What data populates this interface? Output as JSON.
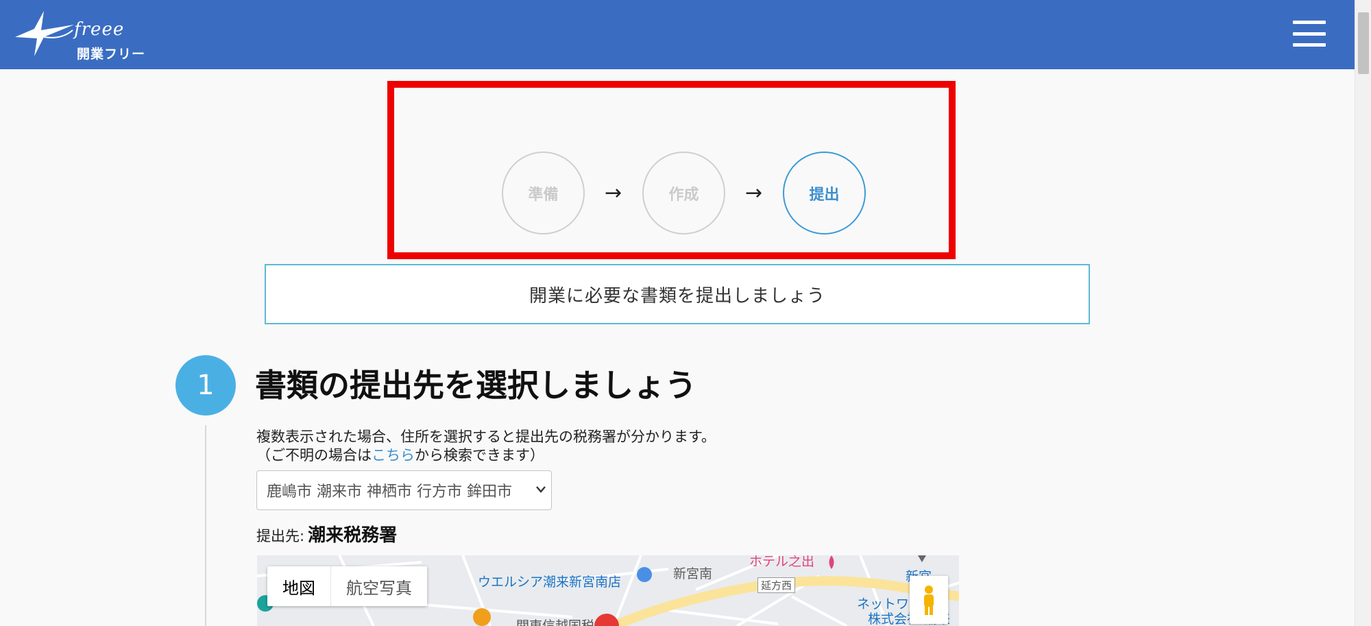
{
  "header": {
    "logo_script": "freee",
    "logo_title": "開業フリー"
  },
  "steps": [
    {
      "label": "準備",
      "state": "done"
    },
    {
      "label": "作成",
      "state": "done"
    },
    {
      "label": "提出",
      "state": "active"
    }
  ],
  "step_arrow": "→",
  "banner_text": "開業に必要な書類を提出しましょう",
  "section1": {
    "number": "1",
    "title": "書類の提出先を選択しましょう",
    "desc_line1": "複数表示された場合、住所を選択すると提出先の税務署が分かります。",
    "desc_line2_pre": "（ご不明の場合は",
    "desc_line2_link": "こちら",
    "desc_line2_post": "から検索できます）",
    "select_value": "鹿嶋市 潮来市 神栖市 行方市 鉾田市",
    "destination_label": "提出先:",
    "destination_value": "潮来税務署"
  },
  "map": {
    "toggle_map": "地図",
    "toggle_satellite": "航空写真",
    "labels": {
      "store": "ウエルシア潮来新宮南店",
      "area": "新宮南",
      "road_sign": "延方西",
      "hotel": "ホテル之出",
      "company_1": "ネットワーク",
      "company_2": "株式会社 潮来",
      "bottom": "関東信越国税",
      "right_fragment": "新宮"
    }
  },
  "colors": {
    "header": "#3a6dc2",
    "highlight_box": "#ee0000",
    "active_step": "#3c9bd6",
    "section_number": "#4ab0e4",
    "link": "#3c8fce"
  }
}
